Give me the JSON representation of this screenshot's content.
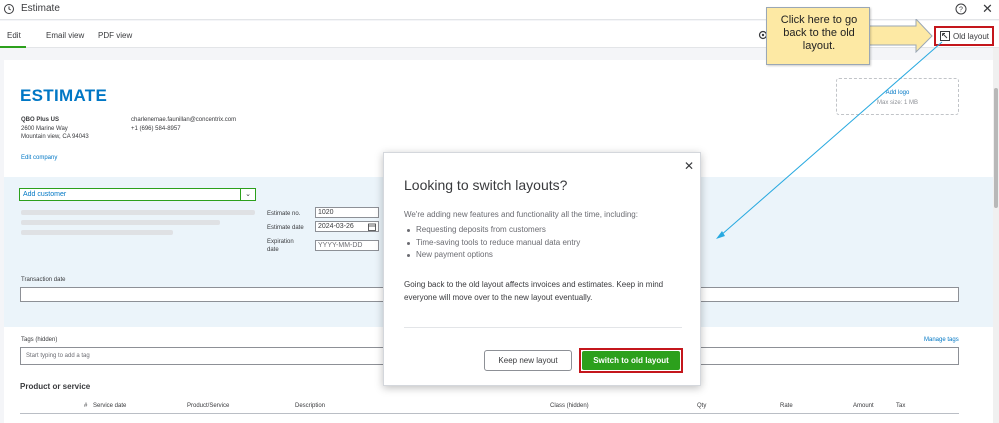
{
  "window": {
    "title": "Estimate"
  },
  "tabs": [
    {
      "label": "Edit",
      "active": true
    },
    {
      "label": "Email view"
    },
    {
      "label": "PDF view"
    }
  ],
  "toolbar": {
    "old_layout_label": "Old layout"
  },
  "callout": {
    "text": "Click here to go back to the old layout."
  },
  "form": {
    "heading": "ESTIMATE",
    "company": {
      "name": "QBO Plus US",
      "address_line1": "2600 Marine Way",
      "address_line2": "Mountain view, CA 94043",
      "email": "charlenemae.faunillan@concentrix.com",
      "phone": "+1 (696) 584-8957",
      "edit_link": "Edit company"
    },
    "logo": {
      "add_label": "Add logo",
      "max_size": "Max size: 1 MB"
    },
    "customer": {
      "placeholder": "Add customer"
    },
    "estimate_no": {
      "label": "Estimate no.",
      "value": "1020"
    },
    "estimate_date": {
      "label": "Estimate date",
      "value": "2024-03-26"
    },
    "expiration_date": {
      "label": "Expiration date",
      "placeholder": "YYYY-MM-DD"
    },
    "transaction_date": {
      "label": "Transaction date"
    },
    "tags": {
      "label": "Tags (hidden)",
      "manage_link": "Manage tags",
      "placeholder": "Start typing to add a tag"
    },
    "product_section": {
      "title": "Product or service",
      "columns": [
        "#",
        "Service date",
        "Product/Service",
        "Description",
        "Class (hidden)",
        "Qty",
        "Rate",
        "Amount",
        "Tax"
      ]
    }
  },
  "modal": {
    "title": "Looking to switch layouts?",
    "intro": "We're adding new features and functionality all the time, including:",
    "bullets": [
      "Requesting deposits from customers",
      "Time-saving tools to reduce manual data entry",
      "New payment options"
    ],
    "warning": "Going back to the old layout affects invoices and estimates. Keep in mind everyone will move over to the new layout eventually.",
    "keep_button": "Keep new layout",
    "switch_button": "Switch to old layout"
  },
  "colors": {
    "brand_blue": "#0077c5",
    "green": "#2ca01c",
    "highlight_red": "#c4161c",
    "callout_yellow": "#fde9a4"
  }
}
